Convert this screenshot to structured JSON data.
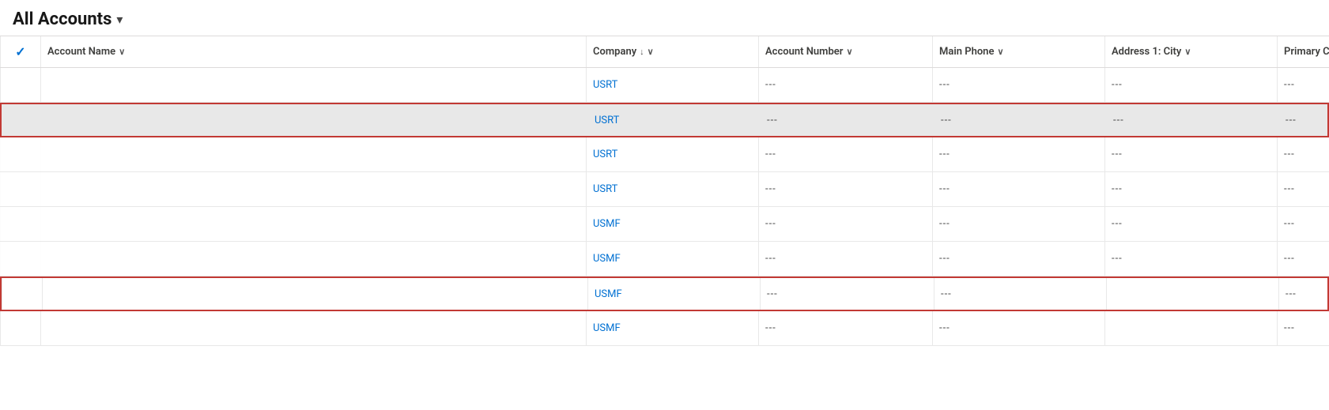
{
  "header": {
    "title": "All Accounts",
    "chevron": "▾"
  },
  "columns": [
    {
      "id": "check",
      "label": "✓",
      "sortable": false
    },
    {
      "id": "account_name",
      "label": "Account Name",
      "sortable": true,
      "chevron": true
    },
    {
      "id": "company",
      "label": "Company",
      "sortable": true,
      "sort_dir": "desc",
      "chevron": true
    },
    {
      "id": "account_number",
      "label": "Account Number",
      "sortable": true,
      "chevron": true
    },
    {
      "id": "main_phone",
      "label": "Main Phone",
      "sortable": true,
      "chevron": true
    },
    {
      "id": "address_city",
      "label": "Address 1: City",
      "sortable": true,
      "chevron": true
    },
    {
      "id": "primary_contact",
      "label": "Primary Contact",
      "sortable": true,
      "chevron": true
    }
  ],
  "rows": [
    {
      "id": "row1",
      "style": "normal",
      "check": "",
      "account_name": "",
      "company": "USRT",
      "account_number": "---",
      "main_phone": "---",
      "address_city": "---",
      "primary_contact": "---"
    },
    {
      "id": "row2",
      "style": "highlighted-red",
      "check": "",
      "account_name": "",
      "company": "USRT",
      "account_number": "---",
      "main_phone": "---",
      "address_city": "---",
      "primary_contact": "---"
    },
    {
      "id": "row3",
      "style": "partial-overlay",
      "check": "",
      "account_name": "",
      "company": "USRT",
      "account_number": "---",
      "main_phone": "---",
      "address_city": "---",
      "primary_contact": "---"
    },
    {
      "id": "row4",
      "style": "partial-overlay",
      "check": "",
      "account_name": "",
      "company": "USRT",
      "account_number": "---",
      "main_phone": "---",
      "address_city": "---",
      "primary_contact": "---"
    },
    {
      "id": "row5",
      "style": "partial-overlay",
      "check": "",
      "account_name": "",
      "company": "USMF",
      "account_number": "---",
      "main_phone": "---",
      "address_city": "---",
      "primary_contact": "---"
    },
    {
      "id": "row6",
      "style": "partial-overlay",
      "check": "",
      "account_name": "",
      "company": "USMF",
      "account_number": "---",
      "main_phone": "---",
      "address_city": "---",
      "primary_contact": "---"
    },
    {
      "id": "row7",
      "style": "red-border",
      "check": "",
      "account_name": "",
      "company": "USMF",
      "account_number": "---",
      "main_phone": "---",
      "address_city": "",
      "primary_contact": "---"
    },
    {
      "id": "row8",
      "style": "normal",
      "check": "",
      "account_name": "",
      "company": "USMF",
      "account_number": "---",
      "main_phone": "---",
      "address_city": "",
      "primary_contact": "---"
    }
  ],
  "empty_dash": "---"
}
